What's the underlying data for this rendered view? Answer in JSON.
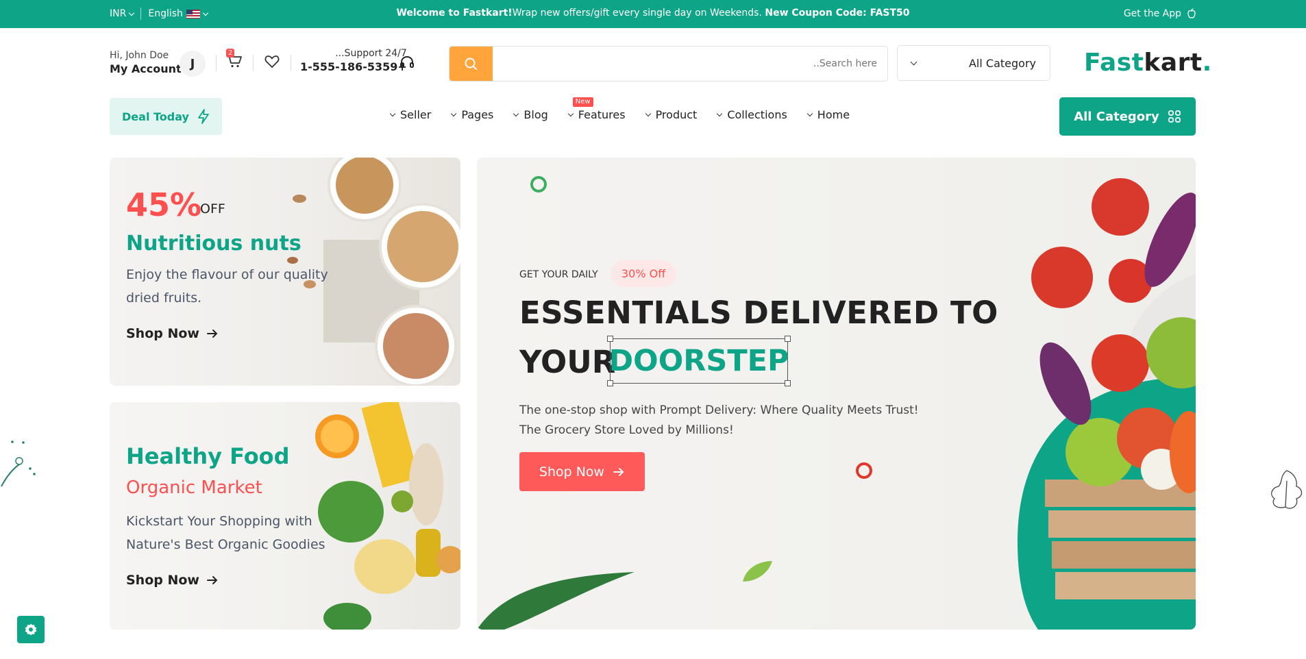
{
  "topbar": {
    "currency": "INR",
    "language": "English",
    "welcome_bold": "Welcome to Fastkart!",
    "welcome_text": "Wrap new offers/gift every single day on Weekends.",
    "coupon": "New Coupon Code: FAST50",
    "get_app": "Get the App"
  },
  "header": {
    "greeting": "Hi, John Doe",
    "account_label": "My Account",
    "avatar_initial": "J",
    "cart_count": "2",
    "support_label": "...Support 24/7",
    "support_phone": "1-555-186-5359+",
    "search_placeholder": "..Search here",
    "category_select": "All Category",
    "logo_fast": "Fast",
    "logo_kart": "kart",
    "logo_dot": "."
  },
  "nav": {
    "deal_today": "Deal Today",
    "items": [
      {
        "label": "Seller"
      },
      {
        "label": "Pages"
      },
      {
        "label": "Blog"
      },
      {
        "label": "Features",
        "badge": "New"
      },
      {
        "label": "Product"
      },
      {
        "label": "Collections"
      },
      {
        "label": "Home"
      }
    ],
    "all_category": "All Category"
  },
  "banners": {
    "nuts": {
      "percent": "45%",
      "off": "OFF",
      "title": "Nutritious nuts",
      "desc": "Enjoy the flavour of our quality dried fruits.",
      "cta": "Shop Now"
    },
    "food": {
      "title": "Healthy Food",
      "subtitle": "Organic Market",
      "desc": "Kickstart Your Shopping with Nature's Best Organic Goodies",
      "cta": "Shop Now"
    },
    "hero": {
      "tag": "GET YOUR DAILY",
      "pill": "30% Off",
      "line1": "ESSENTIALS DELIVERED TO",
      "line2": "YOUR",
      "highlight": "DOORSTEP",
      "p1": "The one-stop shop with Prompt Delivery: Where Quality Meets Trust!",
      "p2": "The Grocery Store Loved by Millions!",
      "cta": "Shop Now"
    }
  },
  "colors": {
    "primary": "#0da487",
    "accent": "#ff4f4f",
    "search_button": "#ffa53b"
  }
}
